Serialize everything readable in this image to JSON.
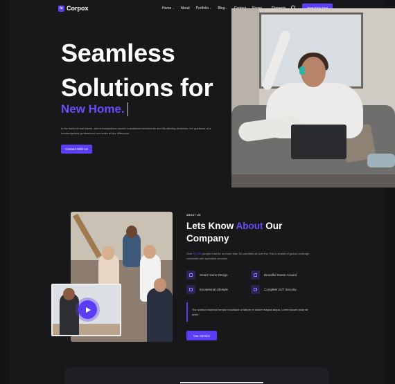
{
  "header": {
    "logo_mark": "lu",
    "logo_text": "Corpox",
    "nav": [
      {
        "label": "Home",
        "caret": "⌄"
      },
      {
        "label": "About",
        "caret": ""
      },
      {
        "label": "Portfolio",
        "caret": "⌄"
      },
      {
        "label": "Blog",
        "caret": "⌄"
      },
      {
        "label": "Contact",
        "caret": ""
      },
      {
        "label": "Pages",
        "caret": "⌄"
      },
      {
        "label": "Elements",
        "caret": "⌄"
      }
    ],
    "cta": "Start Free Trial"
  },
  "hero": {
    "title_line1": "Seamless",
    "title_line2": "Solutions for",
    "accent": "New Home.",
    "description": "In the world of real estate, where transactions involve substantial investments and life-altering decisions, the guidance of a knowledgeable professional can make all the difference.",
    "button": "Contact With Us"
  },
  "about": {
    "eyebrow": "ABOUT US",
    "title_pre": "Lets Know ",
    "title_accent": "About",
    "title_post": " Our Company",
    "desc_pre": "Over ",
    "desc_highlight": "35,000",
    "desc_post": " people trust for us more than 35 countries all over the This is sealed of global coverage , combined with specialist services",
    "features": [
      "Smart Home Design",
      "Beautiful Scene Around",
      "Exceptional Lifestyle",
      "Complete 24/7 Security"
    ],
    "quote": "“Ea nostrud eiusmod tempor incididunt ut labore et dolore magna aliqua. Lorem ipsum dolor sit amet.”",
    "button": "Our Service"
  }
}
